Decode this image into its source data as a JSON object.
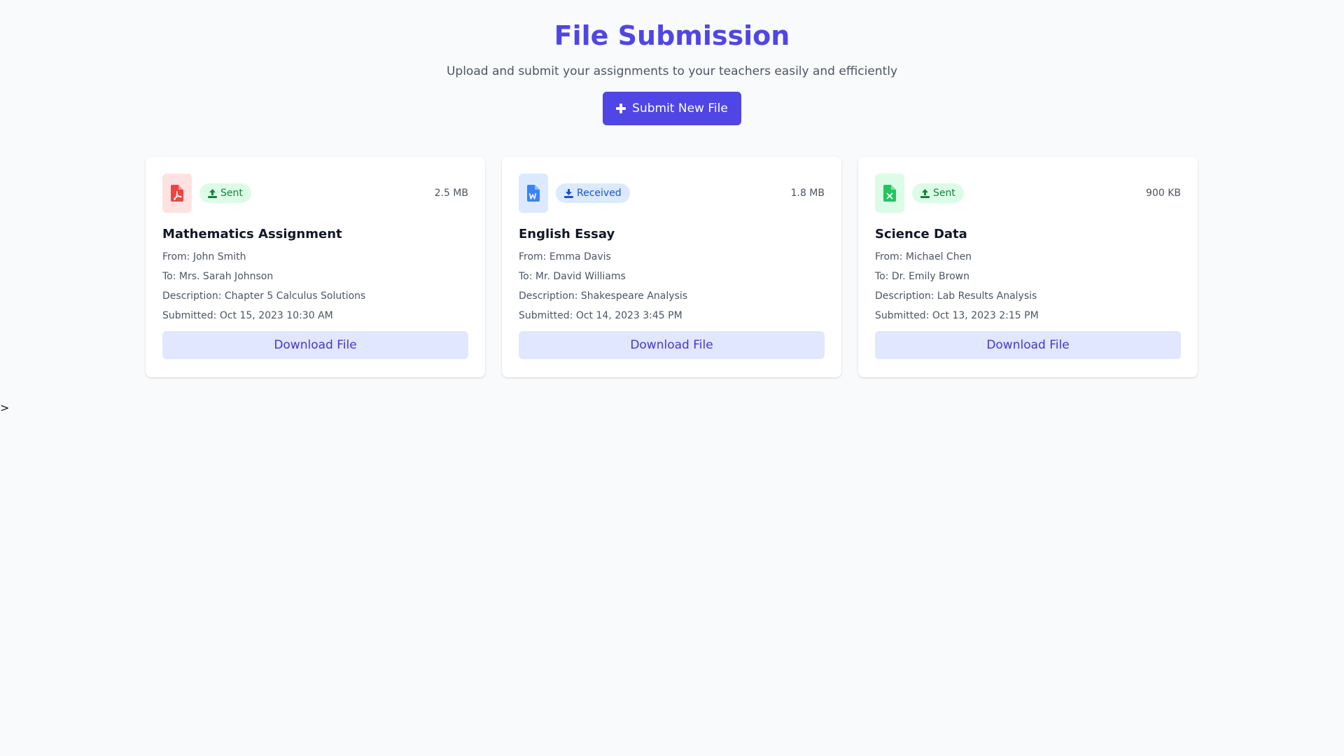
{
  "header": {
    "title": "File Submission",
    "subtitle": "Upload and submit your assignments to your teachers easily and efficiently",
    "submit_label": "Submit New File"
  },
  "files": [
    {
      "file_type": "pdf",
      "icon": "file-pdf-icon",
      "icon_color": "#ef4444",
      "icon_bg": "#fee2e2",
      "status": "Sent",
      "status_icon": "upload-icon",
      "size": "2.5 MB",
      "title": "Mathematics Assignment",
      "from": "From: John Smith",
      "to": "To: Mrs. Sarah Johnson",
      "description": "Description: Chapter 5 Calculus Solutions",
      "submitted": "Submitted: Oct 15, 2023 10:30 AM",
      "download_label": "Download File"
    },
    {
      "file_type": "word",
      "icon": "file-word-icon",
      "icon_color": "#3b82f6",
      "icon_bg": "#dbeafe",
      "status": "Received",
      "status_icon": "download-icon",
      "size": "1.8 MB",
      "title": "English Essay",
      "from": "From: Emma Davis",
      "to": "To: Mr. David Williams",
      "description": "Description: Shakespeare Analysis",
      "submitted": "Submitted: Oct 14, 2023 3:45 PM",
      "download_label": "Download File"
    },
    {
      "file_type": "excel",
      "icon": "file-excel-icon",
      "icon_color": "#22c55e",
      "icon_bg": "#dcfce7",
      "status": "Sent",
      "status_icon": "upload-icon",
      "size": "900 KB",
      "title": "Science Data",
      "from": "From: Michael Chen",
      "to": "To: Dr. Emily Brown",
      "description": "Description: Lab Results Analysis",
      "submitted": "Submitted: Oct 13, 2023 2:15 PM",
      "download_label": "Download File"
    }
  ],
  "status_colors": {
    "Sent": {
      "bg": "#dcfce7",
      "fg": "#15803d"
    },
    "Received": {
      "bg": "#dbeafe",
      "fg": "#1d4ed8"
    }
  },
  "stray_text": ">"
}
